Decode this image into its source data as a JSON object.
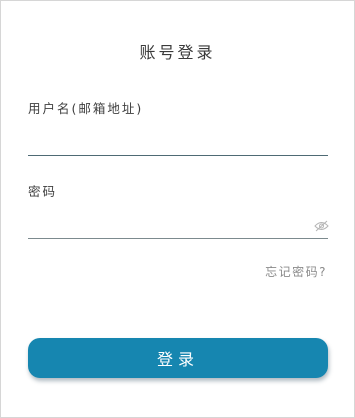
{
  "title": "账号登录",
  "username": {
    "label": "用户名(邮箱地址)",
    "value": ""
  },
  "password": {
    "label": "密码",
    "value": "",
    "visibility_icon": "eye-off-icon"
  },
  "forgot_link": "忘记密码?",
  "login_button": "登录",
  "colors": {
    "accent": "#1686b0",
    "underline": "#4e6a74",
    "muted_text": "#8a8a8a"
  }
}
